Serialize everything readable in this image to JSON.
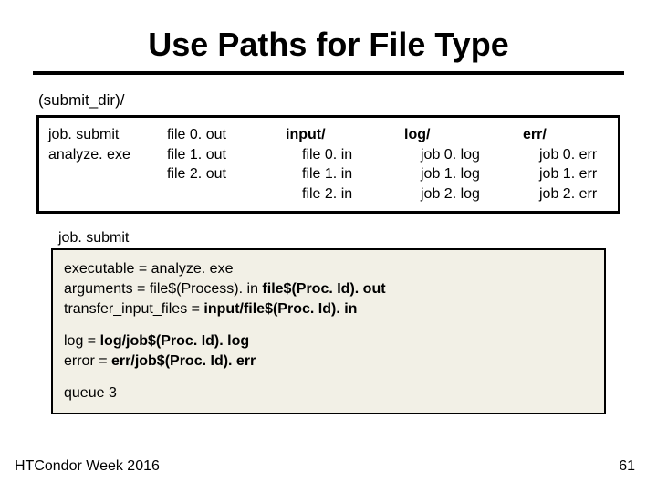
{
  "title": "Use Paths for File Type",
  "dir_label": "(submit_dir)/",
  "cols": {
    "c1": {
      "items": [
        "job. submit",
        "analyze. exe"
      ]
    },
    "c2": {
      "items": [
        "file 0. out",
        "file 1. out",
        "file 2. out"
      ]
    },
    "c3": {
      "header": "input/",
      "items": [
        "file 0. in",
        "file 1. in",
        "file 2. in"
      ]
    },
    "c4": {
      "header": "log/",
      "items": [
        "job 0. log",
        "job 1. log",
        "job 2. log"
      ]
    },
    "c5": {
      "header": "err/",
      "items": [
        "job 0. err",
        "job 1. err",
        "job 2. err"
      ]
    }
  },
  "submit_label": "job. submit",
  "code": {
    "l1a": "executable = analyze. exe",
    "l1b_pre": "arguments = file$(Process). in ",
    "l1b_bold": "file$(Proc. Id). out",
    "l1c_pre": "transfer_input_files = ",
    "l1c_bold": "input/file$(Proc. Id). in",
    "l2a_pre": "log = ",
    "l2a_bold": "log/job$(Proc. Id). log",
    "l2b_pre": "error = ",
    "l2b_bold": "err/job$(Proc. Id). err",
    "l3": "queue 3"
  },
  "footer": {
    "left": "HTCondor Week 2016",
    "right": "61"
  }
}
